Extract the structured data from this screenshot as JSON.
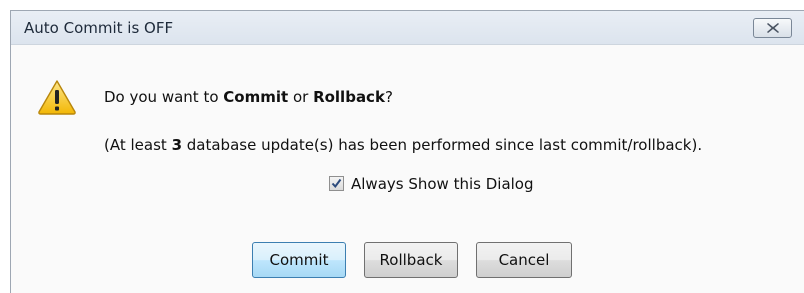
{
  "dialog": {
    "title": "Auto Commit is OFF",
    "close_label": "Close",
    "icon": "warning-icon",
    "message": {
      "prefix": "Do you want to ",
      "commit_word": "Commit",
      "or_text": " or ",
      "rollback_word": "Rollback",
      "suffix": "?"
    },
    "detail": {
      "prefix": "(At least ",
      "count": "3",
      "suffix": " database update(s) has been performed since last commit/rollback)."
    },
    "checkbox": {
      "label": "Always Show this Dialog",
      "checked": true
    },
    "buttons": {
      "commit": "Commit",
      "rollback": "Rollback",
      "cancel": "Cancel"
    },
    "colors": {
      "default_button_border": "#3c7fb1",
      "warning_fill": "#f7c325"
    }
  }
}
